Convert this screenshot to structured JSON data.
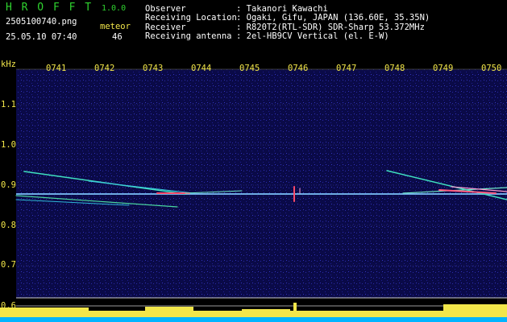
{
  "app": {
    "name": "H R O F F T",
    "version": "1.0.0",
    "filename": "2505100740.png",
    "timestamp": "25.05.10 07:40",
    "meteor_label": "meteor",
    "meteor_count": "46"
  },
  "info": [
    {
      "label": "Observer",
      "value": ": Takanori Kawachi"
    },
    {
      "label": "Receiving Location",
      "value": ": Ogaki, Gifu, JAPAN (136.60E, 35.35N)"
    },
    {
      "label": "Receiver",
      "value": ": R820T2(RTL-SDR) SDR-Sharp 53.372MHz"
    },
    {
      "label": "Receiving antenna",
      "value": ": 2el-HB9CV Vertical (el. E-W)"
    }
  ],
  "axis": {
    "unit": "kHz",
    "time_ticks": [
      "0741",
      "0742",
      "0743",
      "0744",
      "0745",
      "0746",
      "0747",
      "0748",
      "0749",
      "0750"
    ],
    "freq_ticks": [
      "1.1",
      "1.0",
      "0.9",
      "0.8",
      "0.7",
      "0.6"
    ]
  },
  "colors": {
    "background": "#000000",
    "spectrogram_bg": "#0a0a4a",
    "title_green": "#2fd32f",
    "label_yellow": "#f2e64a",
    "carrier": "#8ad0ff",
    "meteor": "#3fe0c0",
    "hot": "#ff4060",
    "level_bar": "#f2e64a",
    "baseline": "#00b4ff"
  }
}
